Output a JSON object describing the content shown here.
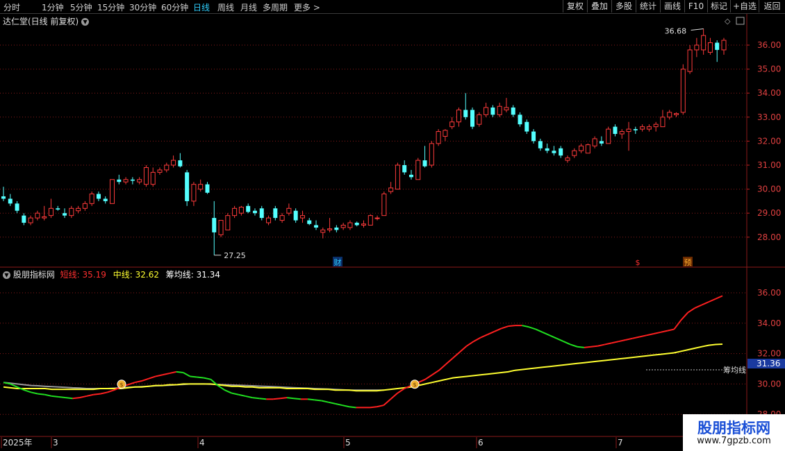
{
  "toolbar": {
    "periods": [
      "分时",
      "1分钟",
      "5分钟",
      "15分钟",
      "30分钟",
      "60分钟",
      "日线",
      "周线",
      "月线",
      "多周期",
      "更多"
    ],
    "active_period": "日线",
    "right_buttons": [
      "复权",
      "叠加",
      "多股",
      "统计",
      "画线",
      "F10",
      "+自选",
      "返回"
    ],
    "mark_button": "标记"
  },
  "main_chart": {
    "title": "达仁堂(日线 前复权)",
    "price_ticks": [
      "36.00",
      "35.00",
      "34.00",
      "33.00",
      "32.00",
      "31.00",
      "30.00",
      "29.00",
      "28.00"
    ],
    "high_label": "36.68",
    "low_label": "27.25",
    "event_markers": [
      "财",
      "$",
      "预"
    ]
  },
  "indicator": {
    "name": "股朋指标网",
    "short_label": "短线:",
    "short_value": "35.19",
    "mid_label": "中线:",
    "mid_value": "32.62",
    "avg_label": "筹均线:",
    "avg_value": "31.34",
    "ticks": [
      "36.00",
      "34.00",
      "32.00",
      "30.00",
      "28.00"
    ],
    "current_tag": "31.36",
    "line_tag": "筹均线"
  },
  "x_axis": {
    "labels": [
      "2025年",
      "3",
      "4",
      "5",
      "6",
      "7"
    ]
  },
  "watermark": {
    "line1": "股朋指标网",
    "line2": "www.7gpzb.com"
  },
  "colors": {
    "up": "#ff3b3b",
    "down": "#54ffff",
    "short_up": "#ff2020",
    "short_down": "#20e020",
    "mid": "#ffff30",
    "avg": "#ffffff",
    "grid": "#8b1a1a",
    "active": "#2fd0ff"
  },
  "chart_data": {
    "type": "candlestick",
    "price_range": [
      27.0,
      37.0
    ],
    "candles": [
      {
        "o": 29.7,
        "h": 30.1,
        "l": 29.5,
        "c": 29.6
      },
      {
        "o": 29.6,
        "h": 29.8,
        "l": 29.3,
        "c": 29.4
      },
      {
        "o": 29.4,
        "h": 29.5,
        "l": 29.0,
        "c": 29.1
      },
      {
        "o": 28.9,
        "h": 29.0,
        "l": 28.5,
        "c": 28.6
      },
      {
        "o": 28.6,
        "h": 28.9,
        "l": 28.5,
        "c": 28.8
      },
      {
        "o": 28.8,
        "h": 29.1,
        "l": 28.7,
        "c": 29.0
      },
      {
        "o": 28.8,
        "h": 29.3,
        "l": 28.7,
        "c": 28.85
      },
      {
        "o": 28.9,
        "h": 29.6,
        "l": 28.8,
        "c": 29.2
      },
      {
        "o": 29.2,
        "h": 29.3,
        "l": 29.1,
        "c": 29.15
      },
      {
        "o": 29.0,
        "h": 29.2,
        "l": 28.8,
        "c": 28.9
      },
      {
        "o": 28.9,
        "h": 29.3,
        "l": 28.8,
        "c": 29.2
      },
      {
        "o": 29.1,
        "h": 29.3,
        "l": 29.0,
        "c": 29.2
      },
      {
        "o": 29.2,
        "h": 29.5,
        "l": 29.1,
        "c": 29.4
      },
      {
        "o": 29.4,
        "h": 29.9,
        "l": 29.3,
        "c": 29.8
      },
      {
        "o": 29.8,
        "h": 29.9,
        "l": 29.5,
        "c": 29.6
      },
      {
        "o": 29.6,
        "h": 29.7,
        "l": 29.4,
        "c": 29.5
      },
      {
        "o": 29.4,
        "h": 30.4,
        "l": 29.4,
        "c": 30.4
      },
      {
        "o": 30.4,
        "h": 30.6,
        "l": 30.2,
        "c": 30.3
      },
      {
        "o": 30.3,
        "h": 30.5,
        "l": 30.2,
        "c": 30.4
      },
      {
        "o": 30.4,
        "h": 30.5,
        "l": 30.2,
        "c": 30.35
      },
      {
        "o": 30.3,
        "h": 30.5,
        "l": 30.2,
        "c": 30.4
      },
      {
        "o": 30.2,
        "h": 31.0,
        "l": 30.1,
        "c": 30.9
      },
      {
        "o": 30.2,
        "h": 30.9,
        "l": 30.1,
        "c": 30.7
      },
      {
        "o": 30.7,
        "h": 30.9,
        "l": 30.6,
        "c": 30.8
      },
      {
        "o": 30.8,
        "h": 31.1,
        "l": 30.7,
        "c": 31.0
      },
      {
        "o": 31.0,
        "h": 31.4,
        "l": 30.9,
        "c": 31.2
      },
      {
        "o": 31.2,
        "h": 31.5,
        "l": 30.9,
        "c": 30.95
      },
      {
        "o": 30.7,
        "h": 30.8,
        "l": 29.3,
        "c": 29.5
      },
      {
        "o": 29.5,
        "h": 30.3,
        "l": 29.3,
        "c": 30.2
      },
      {
        "o": 30.0,
        "h": 30.4,
        "l": 29.9,
        "c": 30.2
      },
      {
        "o": 30.2,
        "h": 30.3,
        "l": 29.8,
        "c": 29.85
      },
      {
        "o": 28.8,
        "h": 29.5,
        "l": 27.25,
        "c": 28.2
      },
      {
        "o": 28.1,
        "h": 28.7,
        "l": 28.0,
        "c": 28.7
      },
      {
        "o": 28.3,
        "h": 29.0,
        "l": 28.3,
        "c": 28.9
      },
      {
        "o": 28.9,
        "h": 29.3,
        "l": 28.8,
        "c": 29.2
      },
      {
        "o": 29.0,
        "h": 29.3,
        "l": 28.9,
        "c": 29.25
      },
      {
        "o": 29.3,
        "h": 29.4,
        "l": 29.0,
        "c": 29.05
      },
      {
        "o": 29.1,
        "h": 29.2,
        "l": 28.9,
        "c": 29.0
      },
      {
        "o": 29.2,
        "h": 29.3,
        "l": 28.7,
        "c": 28.8
      },
      {
        "o": 28.6,
        "h": 28.9,
        "l": 28.5,
        "c": 28.8
      },
      {
        "o": 29.2,
        "h": 29.3,
        "l": 28.7,
        "c": 28.8
      },
      {
        "o": 28.7,
        "h": 29.0,
        "l": 28.6,
        "c": 28.9
      },
      {
        "o": 29.0,
        "h": 29.4,
        "l": 28.9,
        "c": 29.2
      },
      {
        "o": 29.1,
        "h": 29.2,
        "l": 28.6,
        "c": 28.7
      },
      {
        "o": 28.8,
        "h": 29.1,
        "l": 28.6,
        "c": 28.9
      },
      {
        "o": 28.7,
        "h": 28.8,
        "l": 28.5,
        "c": 28.55
      },
      {
        "o": 28.5,
        "h": 28.7,
        "l": 28.3,
        "c": 28.4
      },
      {
        "o": 28.2,
        "h": 28.4,
        "l": 27.95,
        "c": 28.3
      },
      {
        "o": 28.3,
        "h": 28.8,
        "l": 28.2,
        "c": 28.35
      },
      {
        "o": 28.4,
        "h": 28.5,
        "l": 28.2,
        "c": 28.3
      },
      {
        "o": 28.4,
        "h": 28.6,
        "l": 28.3,
        "c": 28.5
      },
      {
        "o": 28.4,
        "h": 28.7,
        "l": 28.3,
        "c": 28.6
      },
      {
        "o": 28.6,
        "h": 28.65,
        "l": 28.45,
        "c": 28.5
      },
      {
        "o": 28.5,
        "h": 28.7,
        "l": 28.4,
        "c": 28.55
      },
      {
        "o": 28.5,
        "h": 28.95,
        "l": 28.5,
        "c": 28.9
      },
      {
        "o": 28.8,
        "h": 28.9,
        "l": 28.7,
        "c": 28.8
      },
      {
        "o": 28.9,
        "h": 29.9,
        "l": 28.9,
        "c": 29.8
      },
      {
        "o": 29.9,
        "h": 30.3,
        "l": 29.8,
        "c": 30.05
      },
      {
        "o": 30.0,
        "h": 31.1,
        "l": 30.0,
        "c": 31.0
      },
      {
        "o": 31.0,
        "h": 31.2,
        "l": 30.6,
        "c": 30.7
      },
      {
        "o": 30.6,
        "h": 30.8,
        "l": 30.4,
        "c": 30.5
      },
      {
        "o": 30.4,
        "h": 31.3,
        "l": 30.4,
        "c": 31.2
      },
      {
        "o": 31.2,
        "h": 31.8,
        "l": 30.9,
        "c": 30.95
      },
      {
        "o": 31.0,
        "h": 32.0,
        "l": 30.9,
        "c": 31.9
      },
      {
        "o": 31.9,
        "h": 32.5,
        "l": 31.8,
        "c": 32.4
      },
      {
        "o": 32.2,
        "h": 32.5,
        "l": 32.0,
        "c": 32.45
      },
      {
        "o": 32.6,
        "h": 33.0,
        "l": 32.5,
        "c": 32.8
      },
      {
        "o": 32.8,
        "h": 33.4,
        "l": 32.6,
        "c": 33.3
      },
      {
        "o": 33.3,
        "h": 34.0,
        "l": 32.9,
        "c": 33.0
      },
      {
        "o": 33.3,
        "h": 33.4,
        "l": 32.5,
        "c": 32.6
      },
      {
        "o": 32.7,
        "h": 33.2,
        "l": 32.6,
        "c": 33.1
      },
      {
        "o": 33.1,
        "h": 33.6,
        "l": 33.0,
        "c": 33.4
      },
      {
        "o": 33.4,
        "h": 33.5,
        "l": 33.0,
        "c": 33.1
      },
      {
        "o": 33.1,
        "h": 33.6,
        "l": 33.0,
        "c": 33.45
      },
      {
        "o": 33.3,
        "h": 33.8,
        "l": 33.2,
        "c": 33.4
      },
      {
        "o": 33.4,
        "h": 33.5,
        "l": 33.0,
        "c": 33.1
      },
      {
        "o": 33.1,
        "h": 33.2,
        "l": 32.6,
        "c": 32.7
      },
      {
        "o": 32.8,
        "h": 32.9,
        "l": 32.3,
        "c": 32.4
      },
      {
        "o": 32.4,
        "h": 32.5,
        "l": 31.9,
        "c": 32.0
      },
      {
        "o": 32.0,
        "h": 32.1,
        "l": 31.6,
        "c": 31.7
      },
      {
        "o": 31.7,
        "h": 31.9,
        "l": 31.5,
        "c": 31.6
      },
      {
        "o": 31.6,
        "h": 31.8,
        "l": 31.4,
        "c": 31.5
      },
      {
        "o": 31.7,
        "h": 31.8,
        "l": 31.3,
        "c": 31.4
      },
      {
        "o": 31.2,
        "h": 31.4,
        "l": 31.1,
        "c": 31.3
      },
      {
        "o": 31.4,
        "h": 31.7,
        "l": 31.3,
        "c": 31.6
      },
      {
        "o": 31.6,
        "h": 31.9,
        "l": 31.5,
        "c": 31.8
      },
      {
        "o": 31.5,
        "h": 31.9,
        "l": 31.5,
        "c": 31.85
      },
      {
        "o": 31.8,
        "h": 32.2,
        "l": 31.7,
        "c": 32.1
      },
      {
        "o": 32.0,
        "h": 32.2,
        "l": 31.8,
        "c": 31.9
      },
      {
        "o": 31.9,
        "h": 32.6,
        "l": 31.9,
        "c": 32.5
      },
      {
        "o": 32.6,
        "h": 32.7,
        "l": 32.2,
        "c": 32.3
      },
      {
        "o": 32.3,
        "h": 32.5,
        "l": 32.1,
        "c": 32.4
      },
      {
        "o": 32.4,
        "h": 32.8,
        "l": 31.6,
        "c": 32.5
      },
      {
        "o": 32.5,
        "h": 32.6,
        "l": 32.3,
        "c": 32.45
      },
      {
        "o": 32.5,
        "h": 32.7,
        "l": 32.4,
        "c": 32.6
      },
      {
        "o": 32.5,
        "h": 32.7,
        "l": 32.4,
        "c": 32.6
      },
      {
        "o": 32.6,
        "h": 32.8,
        "l": 32.4,
        "c": 32.7
      },
      {
        "o": 32.6,
        "h": 33.3,
        "l": 32.6,
        "c": 33.0
      },
      {
        "o": 33.0,
        "h": 33.3,
        "l": 32.9,
        "c": 33.2
      },
      {
        "o": 33.1,
        "h": 33.2,
        "l": 33.0,
        "c": 33.15
      },
      {
        "o": 33.2,
        "h": 35.2,
        "l": 33.1,
        "c": 35.0
      },
      {
        "o": 34.9,
        "h": 36.0,
        "l": 34.8,
        "c": 35.8
      },
      {
        "o": 35.8,
        "h": 36.3,
        "l": 35.5,
        "c": 36.0
      },
      {
        "o": 35.8,
        "h": 36.68,
        "l": 35.6,
        "c": 36.4
      },
      {
        "o": 35.7,
        "h": 36.3,
        "l": 35.6,
        "c": 36.1
      },
      {
        "o": 36.1,
        "h": 36.2,
        "l": 35.3,
        "c": 35.8
      },
      {
        "o": 35.8,
        "h": 36.3,
        "l": 35.6,
        "c": 36.2
      }
    ],
    "indicator_range": [
      28.0,
      37.5
    ],
    "short_line": [
      30.1,
      30.0,
      29.8,
      29.6,
      29.45,
      29.35,
      29.3,
      29.2,
      29.15,
      29.1,
      29.05,
      29.1,
      29.2,
      29.3,
      29.35,
      29.45,
      29.6,
      29.8,
      29.95,
      30.1,
      30.2,
      30.35,
      30.5,
      30.6,
      30.7,
      30.8,
      30.75,
      30.5,
      30.45,
      30.4,
      30.3,
      29.9,
      29.6,
      29.4,
      29.3,
      29.2,
      29.1,
      29.05,
      29.0,
      29.0,
      29.05,
      29.1,
      29.05,
      29.0,
      29.0,
      28.95,
      28.9,
      28.8,
      28.7,
      28.6,
      28.5,
      28.45,
      28.45,
      28.45,
      28.5,
      28.6,
      29.0,
      29.4,
      29.7,
      29.9,
      30.1,
      30.3,
      30.6,
      30.9,
      31.3,
      31.7,
      32.1,
      32.5,
      32.8,
      33.05,
      33.25,
      33.45,
      33.65,
      33.8,
      33.85,
      33.85,
      33.75,
      33.6,
      33.4,
      33.2,
      33.0,
      32.8,
      32.6,
      32.45,
      32.4,
      32.45,
      32.5,
      32.6,
      32.7,
      32.8,
      32.9,
      33.0,
      33.1,
      33.2,
      33.3,
      33.4,
      33.5,
      33.6,
      34.2,
      34.7,
      35.0,
      35.2,
      35.4,
      35.6,
      35.8
    ],
    "mid_line": [
      29.8,
      29.75,
      29.7,
      29.7,
      29.7,
      29.7,
      29.7,
      29.65,
      29.65,
      29.65,
      29.65,
      29.65,
      29.65,
      29.65,
      29.7,
      29.7,
      29.7,
      29.7,
      29.75,
      29.8,
      29.8,
      29.85,
      29.9,
      29.9,
      29.95,
      29.95,
      30.0,
      30.0,
      30.0,
      30.0,
      30.0,
      29.95,
      29.9,
      29.85,
      29.85,
      29.8,
      29.8,
      29.75,
      29.75,
      29.75,
      29.75,
      29.7,
      29.7,
      29.7,
      29.7,
      29.65,
      29.65,
      29.65,
      29.6,
      29.6,
      29.6,
      29.55,
      29.55,
      29.55,
      29.55,
      29.6,
      29.65,
      29.7,
      29.75,
      29.8,
      29.9,
      30.0,
      30.1,
      30.2,
      30.3,
      30.4,
      30.45,
      30.5,
      30.55,
      30.6,
      30.65,
      30.7,
      30.75,
      30.8,
      30.9,
      30.95,
      31.0,
      31.05,
      31.1,
      31.15,
      31.2,
      31.25,
      31.3,
      31.35,
      31.4,
      31.45,
      31.5,
      31.55,
      31.6,
      31.65,
      31.7,
      31.75,
      31.8,
      31.85,
      31.9,
      31.95,
      32.0,
      32.05,
      32.15,
      32.25,
      32.35,
      32.45,
      32.55,
      32.6,
      32.62
    ],
    "avg_line": [
      30.1,
      30.05,
      30.0,
      29.95,
      29.9,
      29.88,
      29.85,
      29.82,
      29.8,
      29.78,
      29.75,
      29.73,
      29.7,
      29.7,
      29.7,
      29.7,
      29.72,
      29.75,
      29.78,
      29.8,
      29.82,
      29.85,
      29.88,
      29.9,
      29.92,
      29.95,
      29.97,
      30.0,
      30.0,
      30.0,
      29.98,
      29.97,
      29.95,
      29.93,
      29.92,
      29.9,
      29.88,
      29.86,
      29.84,
      29.82,
      29.8,
      29.78,
      29.76,
      29.74,
      29.72,
      29.7,
      29.68,
      29.66,
      29.64,
      29.62,
      29.6,
      29.6,
      29.6,
      29.6,
      29.6,
      29.6
    ]
  }
}
